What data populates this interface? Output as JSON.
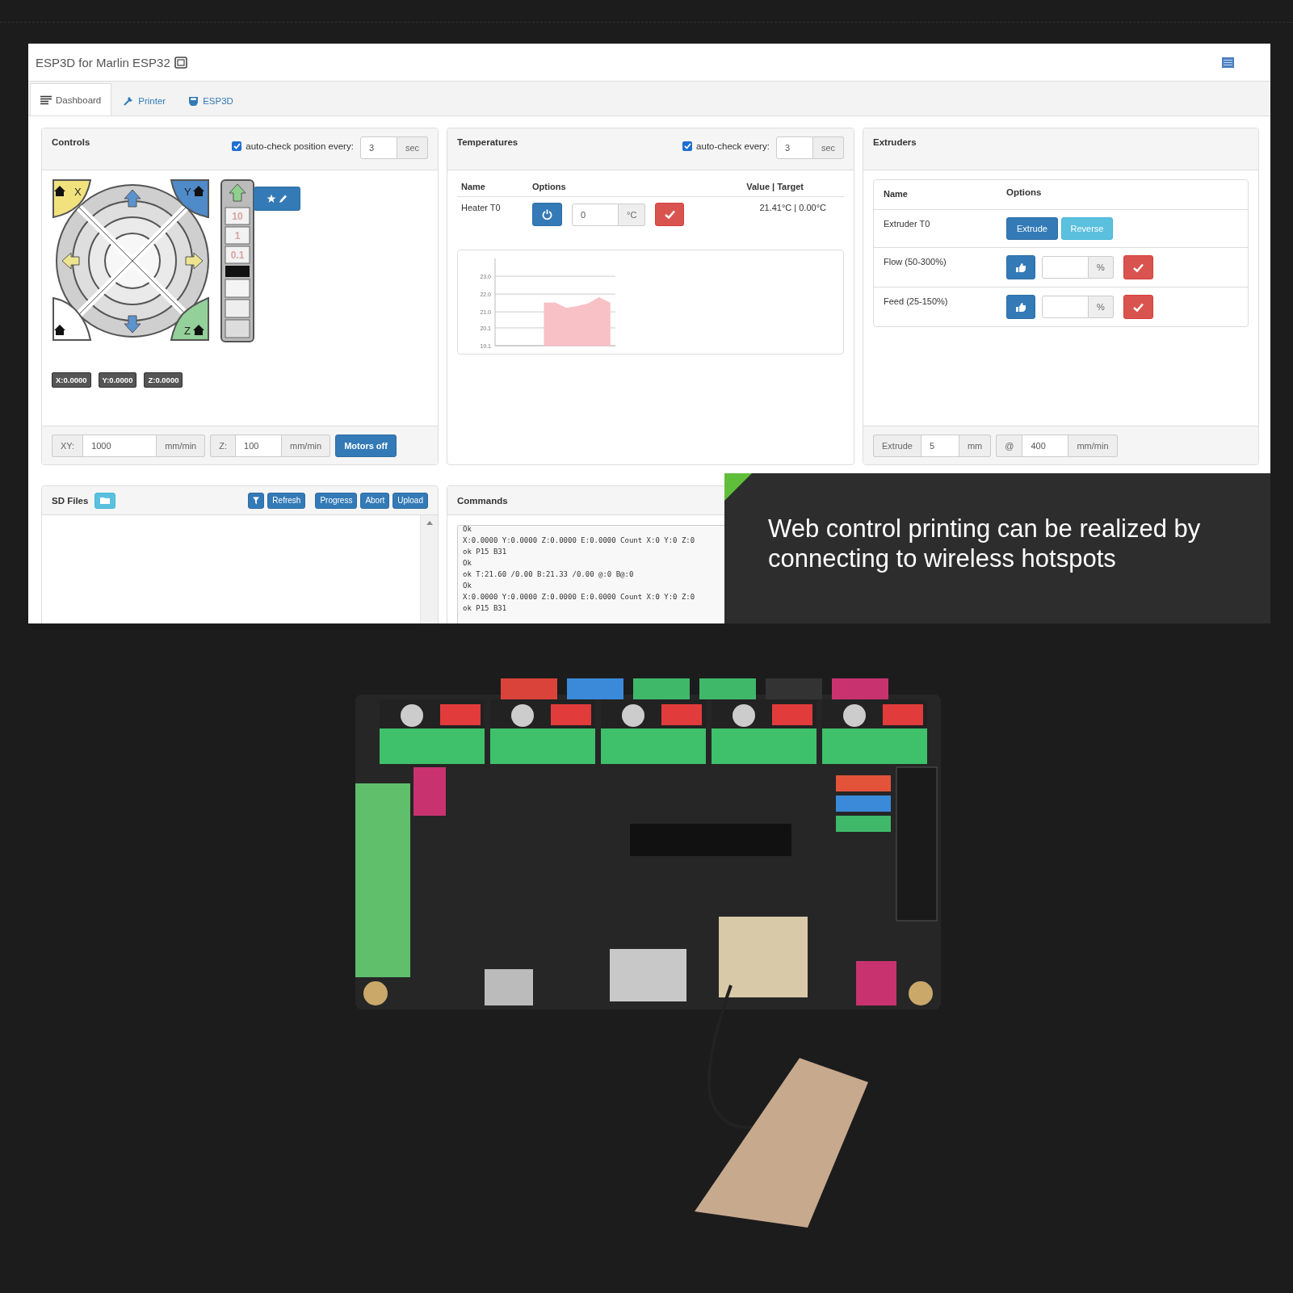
{
  "app": {
    "title": "ESP3D for Marlin ESP32"
  },
  "tabs": [
    {
      "label": "Dashboard",
      "selected": true
    },
    {
      "label": "Printer",
      "selected": false
    },
    {
      "label": "ESP3D",
      "selected": false
    }
  ],
  "controls": {
    "title": "Controls",
    "auto_check": {
      "checked": true,
      "label": "auto-check position every:",
      "value": "3",
      "unit": "sec"
    },
    "jog": {
      "home_buttons": [
        {
          "label": "X",
          "color": "#f2e27d"
        },
        {
          "label": "Y",
          "color": "#4f8ac9"
        },
        {
          "label": "Z",
          "color": "#93d09a"
        },
        {
          "color": "#ffffff"
        }
      ],
      "z_steps": [
        "10",
        "1",
        "0.1"
      ]
    },
    "positions": [
      "X:0.0000",
      "Y:0.0000",
      "Z:0.0000"
    ],
    "feedrates": [
      {
        "label": "XY:",
        "value": "1000",
        "unit": "mm/min"
      },
      {
        "label": "Z:",
        "value": "100",
        "unit": "mm/min"
      }
    ],
    "motors_button": "Motors off"
  },
  "temperatures": {
    "title": "Temperatures",
    "auto_check": {
      "checked": true,
      "label": "auto-check every:",
      "value": "3",
      "unit": "sec"
    },
    "columns": [
      "Name",
      "Options",
      "Value | Target"
    ],
    "heaters": [
      {
        "name": "Heater T0",
        "value": "0",
        "unit": "°C",
        "reading": "21.41°C | 0.00°C"
      }
    ],
    "chart_data": {
      "type": "area",
      "categories": [
        null,
        null,
        null,
        null,
        null,
        null,
        null,
        null,
        null,
        null,
        null
      ],
      "ylim": [
        19.1,
        24
      ],
      "yticks": [
        {
          "value": 23,
          "label": "23.0"
        },
        {
          "value": 22,
          "label": "22.0"
        },
        {
          "value": 21,
          "label": "21.0"
        },
        {
          "value": 20.1,
          "label": "20.1"
        },
        {
          "value": 19.1,
          "label": "19.1"
        }
      ],
      "grid": true,
      "series": [
        {
          "color": "#f7c1c6",
          "values": [
            null,
            null,
            null,
            null,
            21.5,
            21.5,
            21.2,
            21.3,
            21.45,
            21.8,
            21.5
          ]
        }
      ]
    }
  },
  "extruders": {
    "title": "Extruders",
    "columns": [
      "Name",
      "Options"
    ],
    "rows": [
      {
        "kind": "buttons",
        "name": "Extruder T0",
        "buttons": [
          {
            "label": "Extrude",
            "kind": "primary"
          },
          {
            "label": "Reverse",
            "kind": "info"
          }
        ]
      },
      {
        "kind": "percent",
        "name": "Flow (50-300%)",
        "unit": "%"
      },
      {
        "kind": "percent",
        "name": "Feed (25-150%)",
        "unit": "%"
      }
    ],
    "footer": {
      "label": "Extrude",
      "value": "5",
      "unit": "mm",
      "at": "@",
      "speed": "400",
      "speed_unit": "mm/min"
    }
  },
  "sd_files": {
    "title": "SD Files",
    "buttons": [
      "Refresh",
      "Progress",
      "Abort",
      "Upload"
    ]
  },
  "commands": {
    "title": "Commands",
    "lines": [
      "Ok",
      "X:0.0000 Y:0.0000 Z:0.0000 E:0.0000 Count X:0 Y:0 Z:0",
      "ok P15 B31",
      "Ok",
      "ok T:21.60 /0.00 B:21.33 /0.00 @:0 B@:0",
      "Ok",
      "X:0.0000 Y:0.0000 Z:0.0000 E:0.0000 Count X:0 Y:0 Z:0",
      "ok P15 B31"
    ]
  },
  "caption": {
    "text": "Web control printing can be realized by connecting to wireless hotspots"
  }
}
